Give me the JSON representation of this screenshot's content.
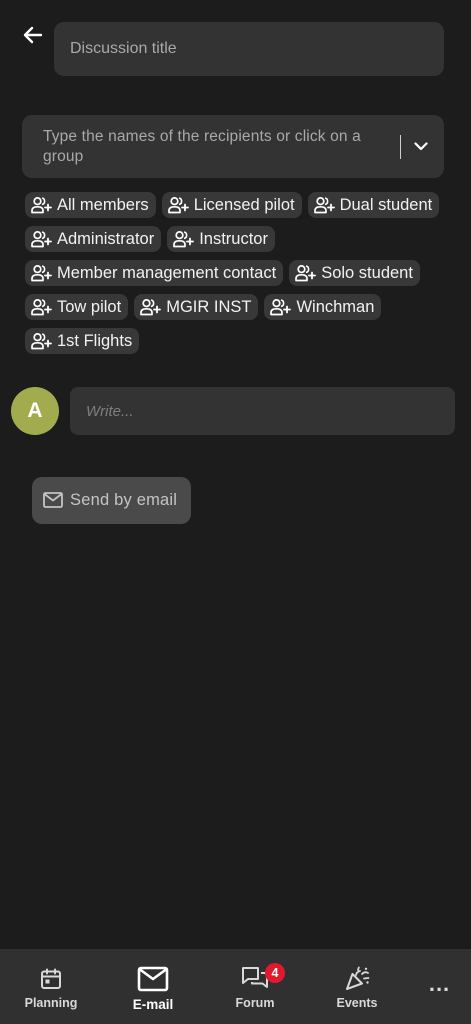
{
  "header": {
    "title_placeholder": "Discussion title"
  },
  "recipients": {
    "placeholder": "Type the names of the recipients or click on a group"
  },
  "groups": [
    "All members",
    "Licensed pilot",
    "Dual student",
    "Administrator",
    "Instructor",
    "Member management contact",
    "Solo student",
    "Tow pilot",
    "MGIR INST",
    "Winchman",
    "1st Flights"
  ],
  "composer": {
    "avatar_initial": "A",
    "placeholder": "Write..."
  },
  "send_email": {
    "label": "Send by email"
  },
  "nav": {
    "planning": "Planning",
    "email": "E-mail",
    "forum": "Forum",
    "forum_badge": "4",
    "events": "Events",
    "more": "..."
  },
  "colors": {
    "background": "#1c1c1c",
    "field": "#333333",
    "chip": "#383838",
    "avatar": "#a2ac4f",
    "badge": "#e4182c",
    "nav_bar": "#303030"
  }
}
